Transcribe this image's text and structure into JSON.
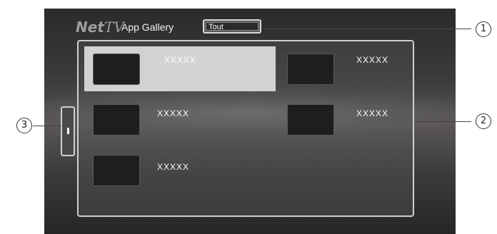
{
  "header": {
    "logo_net": "Net",
    "logo_tv": "TV",
    "title": "App Gallery",
    "filter_value": "Tout"
  },
  "apps": [
    {
      "label": "XXXXX",
      "selected": true
    },
    {
      "label": "XXXXX",
      "selected": false
    },
    {
      "label": "XXXXX",
      "selected": false
    },
    {
      "label": "XXXXX",
      "selected": false
    },
    {
      "label": "XXXXX",
      "selected": false
    }
  ],
  "callouts": {
    "one": "1",
    "two": "2",
    "three": "3"
  }
}
